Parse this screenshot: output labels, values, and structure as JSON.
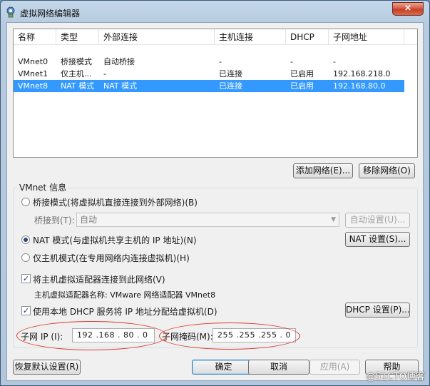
{
  "window": {
    "title": "虚拟网络编辑器",
    "close_symbol": "×"
  },
  "table": {
    "headers": [
      "名称",
      "类型",
      "外部连接",
      "主机连接",
      "DHCP",
      "子网地址"
    ],
    "rows": [
      [
        "VMnet0",
        "桥接模式",
        "自动桥接",
        "-",
        "-",
        "-"
      ],
      [
        "VMnet1",
        "仅主机...",
        "-",
        "已连接",
        "已启用",
        "192.168.218.0"
      ],
      [
        "VMnet8",
        "NAT 模式",
        "NAT 模式",
        "已连接",
        "已启用",
        "192.168.80.0"
      ]
    ],
    "selected_index": 2
  },
  "buttons": {
    "add_network": "添加网络(E)...",
    "remove_network": "移除网络(O)",
    "auto_settings": "自动设置(U)...",
    "nat_settings": "NAT 设置(S)...",
    "dhcp_settings": "DHCP 设置(P)...",
    "restore_defaults": "恢复默认设置(R)",
    "ok": "确定",
    "cancel": "取消",
    "apply": "应用(A)",
    "help": "帮助"
  },
  "vmnet_info": {
    "group_title": "VMnet 信息",
    "bridge_mode": "桥接模式(将虚拟机直接连接到外部网络)(B)",
    "bridge_to_label": "桥接到(T):",
    "bridge_to_value": "自动",
    "nat_mode": "NAT 模式(与虚拟机共享主机的 IP 地址)(N)",
    "host_only_mode": "仅主机模式(在专用网络内连接虚拟机)(H)",
    "selected_mode": "nat",
    "connect_adapter": "将主机虚拟适配器连接到此网络(V)",
    "connect_adapter_checked": true,
    "adapter_name": "主机虚拟适配器名称: VMware 网络适配器 VMnet8",
    "use_dhcp": "使用本地 DHCP 服务将 IP 地址分配给虚拟机(D)",
    "use_dhcp_checked": true,
    "subnet_ip_label": "子网 IP (I):",
    "subnet_ip": "192 .168 . 80 . 0",
    "subnet_mask_label": "子网掩码(M):",
    "subnet_mask": "255 .255 .255 . 0"
  },
  "watermark": "@51CTO博客",
  "check_mark": "✓",
  "accent_color": "#3399ff",
  "annotation_color": "#d93a2b"
}
